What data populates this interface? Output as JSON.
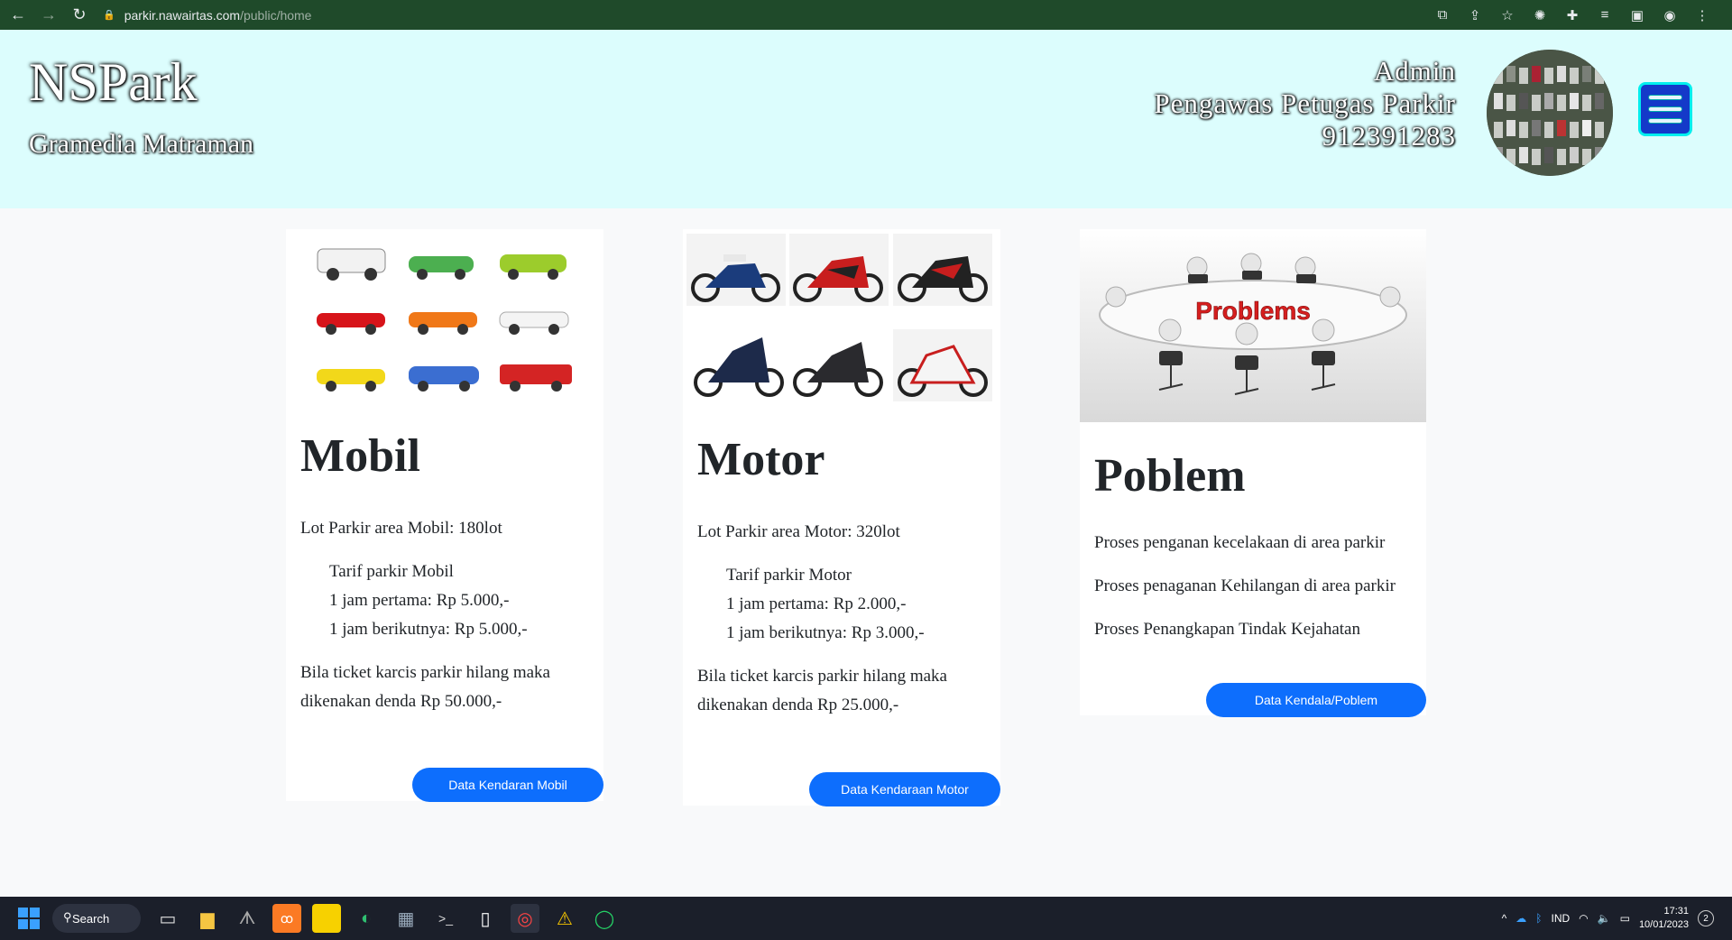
{
  "browser": {
    "url_host": "parkir.nawairtas.com",
    "url_path": "/public/home"
  },
  "header": {
    "brand": "NSPark",
    "branch": "Gramedia Matraman",
    "user_role": "Admin",
    "user_title": "Pengawas Petugas Parkir",
    "user_id": "912391283"
  },
  "cards": {
    "mobil": {
      "title": "Mobil",
      "lot": "Lot Parkir area Mobil: 180lot",
      "tarif_title": "Tarif parkir Mobil",
      "tarif_first": "1 jam pertama: Rp 5.000,-",
      "tarif_next": "1 jam berikutnya: Rp 5.000,-",
      "denda": "Bila ticket karcis parkir hilang maka dikenakan denda Rp 50.000,-",
      "button": "Data Kendaran Mobil"
    },
    "motor": {
      "title": "Motor",
      "lot": "Lot Parkir area Motor: 320lot",
      "tarif_title": "Tarif parkir Motor",
      "tarif_first": "1 jam pertama: Rp 2.000,-",
      "tarif_next": "1 jam berikutnya: Rp 3.000,-",
      "denda": "Bila ticket karcis parkir hilang maka dikenakan denda Rp 25.000,-",
      "button": "Data Kendaraan Motor"
    },
    "problem": {
      "title": "Poblem",
      "image_text": "Problems",
      "item1": "Proses penganan kecelakaan di area parkir",
      "item2": "Proses penaganan Kehilangan di area parkir",
      "item3": "Proses Penangkapan Tindak Kejahatan",
      "button": "Data Kendala/Poblem"
    }
  },
  "taskbar": {
    "search": "Search",
    "lang": "IND",
    "time": "17:31",
    "date": "10/01/2023",
    "badge": "2"
  },
  "colors": {
    "header_bg": "#dcfdfd",
    "button": "#0d6efd",
    "browser_bar": "#1f4a2a"
  }
}
